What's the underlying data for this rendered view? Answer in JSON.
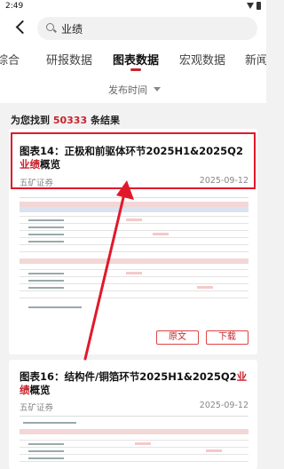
{
  "status_bar": {
    "time": "2:49"
  },
  "search": {
    "query": "业绩"
  },
  "tabs": [
    {
      "label": "综合"
    },
    {
      "label": "研报数据"
    },
    {
      "label": "图表数据"
    },
    {
      "label": "宏观数据"
    },
    {
      "label": "新闻"
    }
  ],
  "active_tab": "图表数据",
  "filter": {
    "label": "发布时间"
  },
  "results": {
    "prefix": "为您找到",
    "count": "50333",
    "suffix": "条结果"
  },
  "cards": [
    {
      "title_pre": "图表14：正极和前驱体环节2025H1&2025Q2",
      "title_hl": "业绩",
      "title_post": "概览",
      "source": "五矿证券",
      "date": "2025-09-12",
      "btn_orig": "原文",
      "btn_download": "下载"
    },
    {
      "title_pre": "图表16：结构件/铜箔环节2025H1&2025Q2",
      "title_hl": "业绩",
      "title_post": "概览",
      "source": "五矿证券",
      "date": "2025-09-12"
    }
  ],
  "colors": {
    "accent": "#c8232d",
    "highlight_box": "#e0192a"
  }
}
